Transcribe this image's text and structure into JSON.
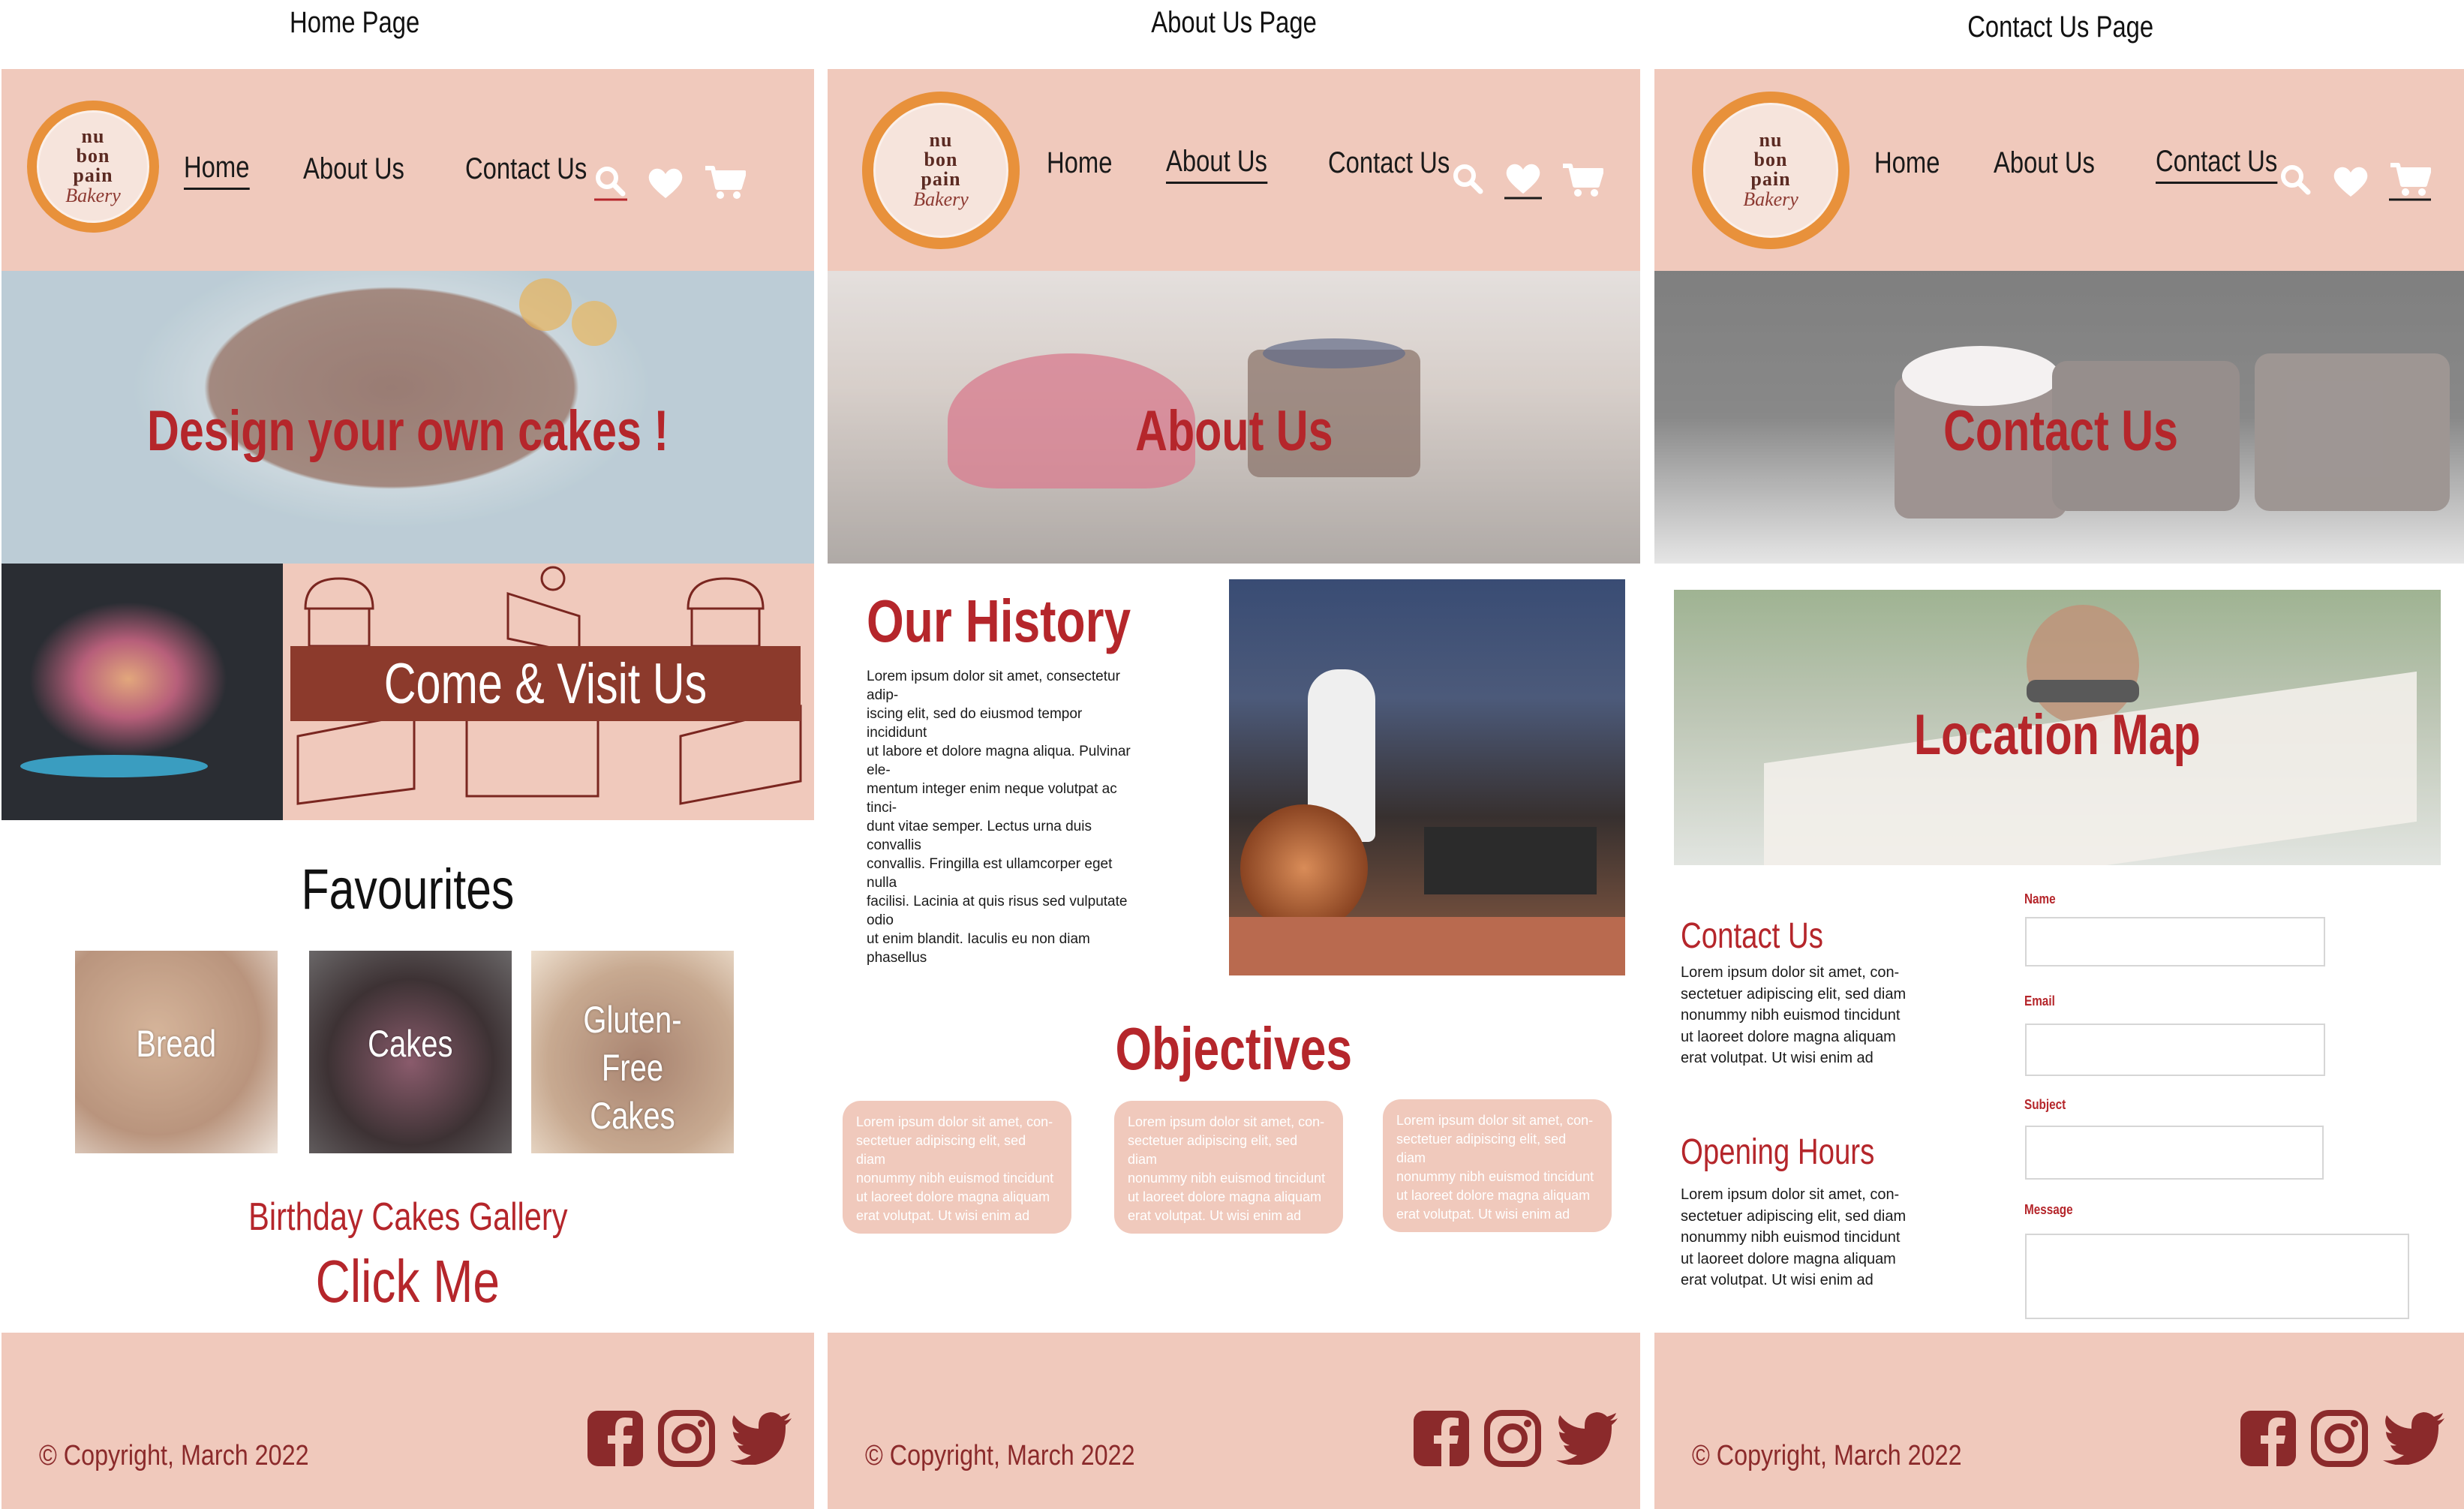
{
  "labels": {
    "home": "Home Page",
    "about": "About Us Page",
    "contact": "Contact Us Page"
  },
  "brand": {
    "logo_line1": "nu",
    "logo_line2": "bon",
    "logo_line3": "pain",
    "logo_script": "Bakery",
    "accent_color": "#b5262b",
    "header_color": "#f0c9bc"
  },
  "nav": {
    "home": "Home",
    "about": "About Us",
    "contact": "Contact Us"
  },
  "icons": {
    "search": "search-icon",
    "heart": "heart-icon",
    "cart": "cart-icon",
    "facebook": "facebook-icon",
    "instagram": "instagram-icon",
    "twitter": "twitter-icon"
  },
  "home": {
    "hero_title": "Design your own cakes !",
    "visit_banner": "Come & Visit Us",
    "favourites_title": "Favourites",
    "favourites": [
      {
        "label": "Bread"
      },
      {
        "label": "Cakes"
      },
      {
        "label": "Gluten- Free Cakes"
      }
    ],
    "gallery_title": "Birthday Cakes Gallery",
    "gallery_link": "Click Me"
  },
  "about": {
    "hero_title": "About Us",
    "history_title": "Our History",
    "history_lines": [
      "Lorem ipsum dolor sit amet, consectetur adip-",
      "iscing elit, sed do eiusmod tempor incididunt",
      "ut labore et dolore magna aliqua. Pulvinar ele-",
      "mentum integer enim neque volutpat ac tinci-",
      "dunt vitae semper. Lectus urna duis convallis",
      "convallis. Fringilla est ullamcorper eget nulla",
      "facilisi. Lacinia at quis risus sed vulputate odio",
      "ut enim blandit. Iaculis eu non diam phasellus"
    ],
    "objectives_title": "Objectives",
    "objective_lines": [
      "Lorem ipsum dolor sit amet, con-",
      "sectetuer adipiscing elit, sed diam",
      "nonummy nibh euismod tincidunt",
      "ut laoreet dolore magna aliquam",
      "erat volutpat. Ut wisi enim ad"
    ]
  },
  "contact": {
    "hero_title": "Contact Us",
    "map_title": "Location Map",
    "contact_title": "Contact Us",
    "hours_title": "Opening Hours",
    "info_lines": [
      "Lorem ipsum dolor sit amet, con-",
      "sectetuer adipiscing elit, sed diam",
      "nonummy nibh euismod tincidunt",
      "ut laoreet dolore magna aliquam",
      "erat volutpat. Ut wisi enim ad"
    ],
    "form": {
      "name": "Name",
      "email": "Email",
      "subject": "Subject",
      "message": "Message"
    }
  },
  "footer": {
    "copyright": "© Copyright, March 2022"
  }
}
